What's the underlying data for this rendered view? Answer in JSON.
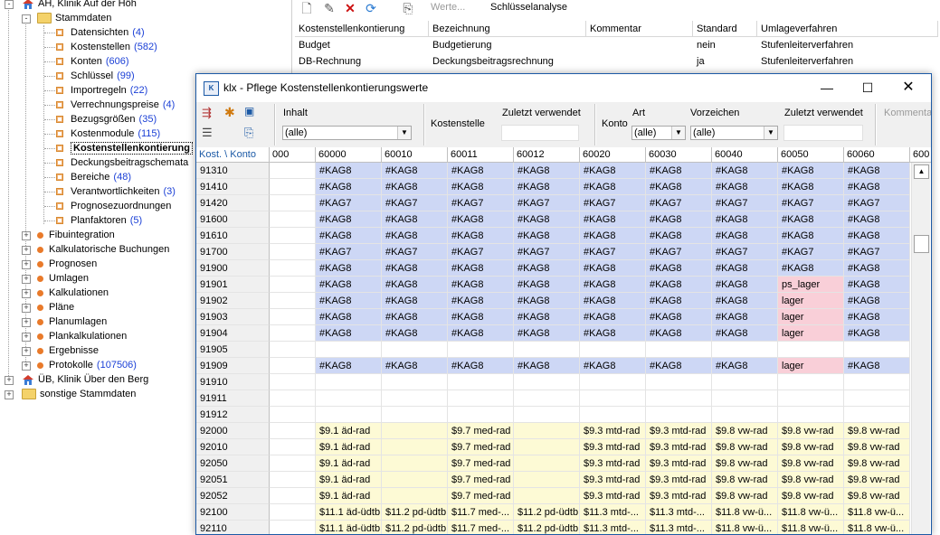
{
  "tree": {
    "items": [
      {
        "label": "AH, Klinik Auf der Höh",
        "level": 0,
        "icon": "house-icon",
        "expander": "-"
      },
      {
        "label": "Stammdaten",
        "level": 1,
        "icon": "folder-icon",
        "expander": "-"
      },
      {
        "label": "Datensichten",
        "count": "(4)",
        "level": 2,
        "icon": "node-icon"
      },
      {
        "label": "Kostenstellen",
        "count": "(582)",
        "level": 2,
        "icon": "node-icon"
      },
      {
        "label": "Konten",
        "count": "(606)",
        "level": 2,
        "icon": "node-icon"
      },
      {
        "label": "Schlüssel",
        "count": "(99)",
        "level": 2,
        "icon": "node-icon"
      },
      {
        "label": "Importregeln",
        "count": "(22)",
        "level": 2,
        "icon": "node-icon"
      },
      {
        "label": "Verrechnungspreise",
        "count": "(4)",
        "level": 2,
        "icon": "node-icon"
      },
      {
        "label": "Bezugsgrößen",
        "count": "(35)",
        "level": 2,
        "icon": "node-icon"
      },
      {
        "label": "Kostenmodule",
        "count": "(115)",
        "level": 2,
        "icon": "node-icon"
      },
      {
        "label": "Kostenstellenkontierung",
        "level": 2,
        "icon": "node-icon",
        "selected": true
      },
      {
        "label": "Deckungsbeitragschemata",
        "level": 2,
        "icon": "node-icon"
      },
      {
        "label": "Bereiche",
        "count": "(48)",
        "level": 2,
        "icon": "node-icon"
      },
      {
        "label": "Verantwortlichkeiten",
        "count": "(3)",
        "level": 2,
        "icon": "node-icon"
      },
      {
        "label": "Prognosezuordnungen",
        "level": 2,
        "icon": "node-icon"
      },
      {
        "label": "Planfaktoren",
        "count": "(5)",
        "level": 2,
        "icon": "node-icon"
      },
      {
        "label": "Fibuintegration",
        "level": 1,
        "icon": "bullet-icon",
        "expander": "+"
      },
      {
        "label": "Kalkulatorische Buchungen",
        "level": 1,
        "icon": "bullet-icon",
        "expander": "+"
      },
      {
        "label": "Prognosen",
        "level": 1,
        "icon": "bullet-icon",
        "expander": "+"
      },
      {
        "label": "Umlagen",
        "level": 1,
        "icon": "bullet-icon",
        "expander": "+"
      },
      {
        "label": "Kalkulationen",
        "level": 1,
        "icon": "bullet-icon",
        "expander": "+"
      },
      {
        "label": "Pläne",
        "level": 1,
        "icon": "bullet-icon",
        "expander": "+"
      },
      {
        "label": "Planumlagen",
        "level": 1,
        "icon": "bullet-icon",
        "expander": "+"
      },
      {
        "label": "Plankalkulationen",
        "level": 1,
        "icon": "bullet-icon",
        "expander": "+"
      },
      {
        "label": "Ergebnisse",
        "level": 1,
        "icon": "bullet-icon",
        "expander": "+"
      },
      {
        "label": "Protokolle",
        "count": "(107506)",
        "level": 1,
        "icon": "bullet-icon",
        "expander": "+"
      },
      {
        "label": "ÜB, Klinik Über den Berg",
        "level": 0,
        "icon": "house-icon",
        "expander": "+"
      },
      {
        "label": "sonstige Stammdaten",
        "level": 0,
        "icon": "folder-icon",
        "expander": "+"
      }
    ]
  },
  "bg_window": {
    "toolbar": {
      "werte": "Werte...",
      "schluessel": "Schlüsselanalyse"
    },
    "columns": [
      "Kostenstellenkontierung",
      "Bezeichnung",
      "Kommentar",
      "Standard",
      "Umlageverfahren"
    ],
    "rows": [
      [
        "Budget",
        "Budgetierung",
        "",
        "nein",
        "Stufenleiterverfahren"
      ],
      [
        "DB-Rechnung",
        "Deckungsbeitragsrechnung",
        "",
        "ja",
        "Stufenleiterverfahren"
      ]
    ]
  },
  "dialog": {
    "title": "klx - Pflege Kostenstellenkontierungswerte",
    "icon_text": "K",
    "filters": {
      "inhalt_label": "Inhalt",
      "inhalt_value": "(alle)",
      "kostenstelle_label": "Kostenstelle",
      "zuletzt1_label": "Zuletzt verwendet",
      "konto_label": "Konto",
      "art_label": "Art",
      "art_value": "(alle)",
      "vorzeichen_label": "Vorzeichen",
      "vorzeichen_value": "(alle)",
      "zuletzt2_label": "Zuletzt verwendet",
      "kommentar_label": "Kommenta"
    },
    "grid": {
      "corner": "Kost. \\ Konto",
      "columns": [
        "000",
        "60000",
        "60010",
        "60011",
        "60012",
        "60020",
        "60030",
        "60040",
        "60050",
        "60060",
        "600"
      ],
      "rows": [
        {
          "id": "91310",
          "c": "blue",
          "v": [
            "",
            "#KAG8",
            "#KAG8",
            "#KAG8",
            "#KAG8",
            "#KAG8",
            "#KAG8",
            "#KAG8",
            "#KAG8",
            "#KAG8"
          ]
        },
        {
          "id": "91410",
          "c": "blue",
          "v": [
            "",
            "#KAG8",
            "#KAG8",
            "#KAG8",
            "#KAG8",
            "#KAG8",
            "#KAG8",
            "#KAG8",
            "#KAG8",
            "#KAG8"
          ]
        },
        {
          "id": "91420",
          "c": "blue",
          "v": [
            "",
            "#KAG7",
            "#KAG7",
            "#KAG7",
            "#KAG7",
            "#KAG7",
            "#KAG7",
            "#KAG7",
            "#KAG7",
            "#KAG7"
          ]
        },
        {
          "id": "91600",
          "c": "blue",
          "v": [
            "",
            "#KAG8",
            "#KAG8",
            "#KAG8",
            "#KAG8",
            "#KAG8",
            "#KAG8",
            "#KAG8",
            "#KAG8",
            "#KAG8"
          ]
        },
        {
          "id": "91610",
          "c": "blue",
          "v": [
            "",
            "#KAG8",
            "#KAG8",
            "#KAG8",
            "#KAG8",
            "#KAG8",
            "#KAG8",
            "#KAG8",
            "#KAG8",
            "#KAG8"
          ]
        },
        {
          "id": "91700",
          "c": "blue",
          "v": [
            "",
            "#KAG7",
            "#KAG7",
            "#KAG7",
            "#KAG7",
            "#KAG7",
            "#KAG7",
            "#KAG7",
            "#KAG7",
            "#KAG7"
          ]
        },
        {
          "id": "91900",
          "c": "blue",
          "v": [
            "",
            "#KAG8",
            "#KAG8",
            "#KAG8",
            "#KAG8",
            "#KAG8",
            "#KAG8",
            "#KAG8",
            "#KAG8",
            "#KAG8"
          ]
        },
        {
          "id": "91901",
          "c": "blue",
          "v": [
            "",
            "#KAG8",
            "#KAG8",
            "#KAG8",
            "#KAG8",
            "#KAG8",
            "#KAG8",
            "#KAG8",
            "ps_lager",
            "#KAG8"
          ],
          "pink": 8
        },
        {
          "id": "91902",
          "c": "blue",
          "v": [
            "",
            "#KAG8",
            "#KAG8",
            "#KAG8",
            "#KAG8",
            "#KAG8",
            "#KAG8",
            "#KAG8",
            "lager",
            "#KAG8"
          ],
          "pink": 8
        },
        {
          "id": "91903",
          "c": "blue",
          "v": [
            "",
            "#KAG8",
            "#KAG8",
            "#KAG8",
            "#KAG8",
            "#KAG8",
            "#KAG8",
            "#KAG8",
            "lager",
            "#KAG8"
          ],
          "pink": 8
        },
        {
          "id": "91904",
          "c": "blue",
          "v": [
            "",
            "#KAG8",
            "#KAG8",
            "#KAG8",
            "#KAG8",
            "#KAG8",
            "#KAG8",
            "#KAG8",
            "lager",
            "#KAG8"
          ],
          "pink": 8
        },
        {
          "id": "91905",
          "c": "empty",
          "v": [
            "",
            "",
            "",
            "",
            "",
            "",
            "",
            "",
            "",
            ""
          ]
        },
        {
          "id": "91909",
          "c": "blue",
          "v": [
            "",
            "#KAG8",
            "#KAG8",
            "#KAG8",
            "#KAG8",
            "#KAG8",
            "#KAG8",
            "#KAG8",
            "lager",
            "#KAG8"
          ],
          "pink": 8
        },
        {
          "id": "91910",
          "c": "empty",
          "v": [
            "",
            "",
            "",
            "",
            "",
            "",
            "",
            "",
            "",
            ""
          ]
        },
        {
          "id": "91911",
          "c": "empty",
          "v": [
            "",
            "",
            "",
            "",
            "",
            "",
            "",
            "",
            "",
            ""
          ]
        },
        {
          "id": "91912",
          "c": "empty",
          "v": [
            "",
            "",
            "",
            "",
            "",
            "",
            "",
            "",
            "",
            ""
          ]
        },
        {
          "id": "92000",
          "c": "yellow",
          "v": [
            "",
            "$9.1 äd-rad",
            "",
            "$9.7 med-rad",
            "",
            "$9.3 mtd-rad",
            "$9.3 mtd-rad",
            "$9.8 vw-rad",
            "$9.8 vw-rad",
            "$9.8 vw-rad"
          ]
        },
        {
          "id": "92010",
          "c": "yellow",
          "v": [
            "",
            "$9.1 äd-rad",
            "",
            "$9.7 med-rad",
            "",
            "$9.3 mtd-rad",
            "$9.3 mtd-rad",
            "$9.8 vw-rad",
            "$9.8 vw-rad",
            "$9.8 vw-rad"
          ]
        },
        {
          "id": "92050",
          "c": "yellow",
          "v": [
            "",
            "$9.1 äd-rad",
            "",
            "$9.7 med-rad",
            "",
            "$9.3 mtd-rad",
            "$9.3 mtd-rad",
            "$9.8 vw-rad",
            "$9.8 vw-rad",
            "$9.8 vw-rad"
          ]
        },
        {
          "id": "92051",
          "c": "yellow",
          "v": [
            "",
            "$9.1 äd-rad",
            "",
            "$9.7 med-rad",
            "",
            "$9.3 mtd-rad",
            "$9.3 mtd-rad",
            "$9.8 vw-rad",
            "$9.8 vw-rad",
            "$9.8 vw-rad"
          ]
        },
        {
          "id": "92052",
          "c": "yellow",
          "v": [
            "",
            "$9.1 äd-rad",
            "",
            "$9.7 med-rad",
            "",
            "$9.3 mtd-rad",
            "$9.3 mtd-rad",
            "$9.8 vw-rad",
            "$9.8 vw-rad",
            "$9.8 vw-rad"
          ]
        },
        {
          "id": "92100",
          "c": "yellow",
          "v": [
            "",
            "$11.1 äd-üdtb",
            "$11.2 pd-üdtb",
            "$11.7 med-...",
            "$11.2 pd-üdtb",
            "$11.3 mtd-...",
            "$11.3 mtd-...",
            "$11.8 vw-ü...",
            "$11.8 vw-ü...",
            "$11.8 vw-ü..."
          ]
        },
        {
          "id": "92110",
          "c": "yellow",
          "v": [
            "",
            "$11.1 äd-üdtb",
            "$11.2 pd-üdtb",
            "$11.7 med-...",
            "$11.2 pd-üdtb",
            "$11.3 mtd-...",
            "$11.3 mtd-...",
            "$11.8 vw-ü...",
            "$11.8 vw-ü...",
            "$11.8 vw-ü..."
          ]
        }
      ]
    }
  },
  "colors": {
    "blue_row": "#cdd7f5",
    "pink_cell": "#f9cfd8",
    "yellow_row": "#fdfad5",
    "window_border": "#1c5aa6",
    "count_text": "#1a3fd6"
  }
}
